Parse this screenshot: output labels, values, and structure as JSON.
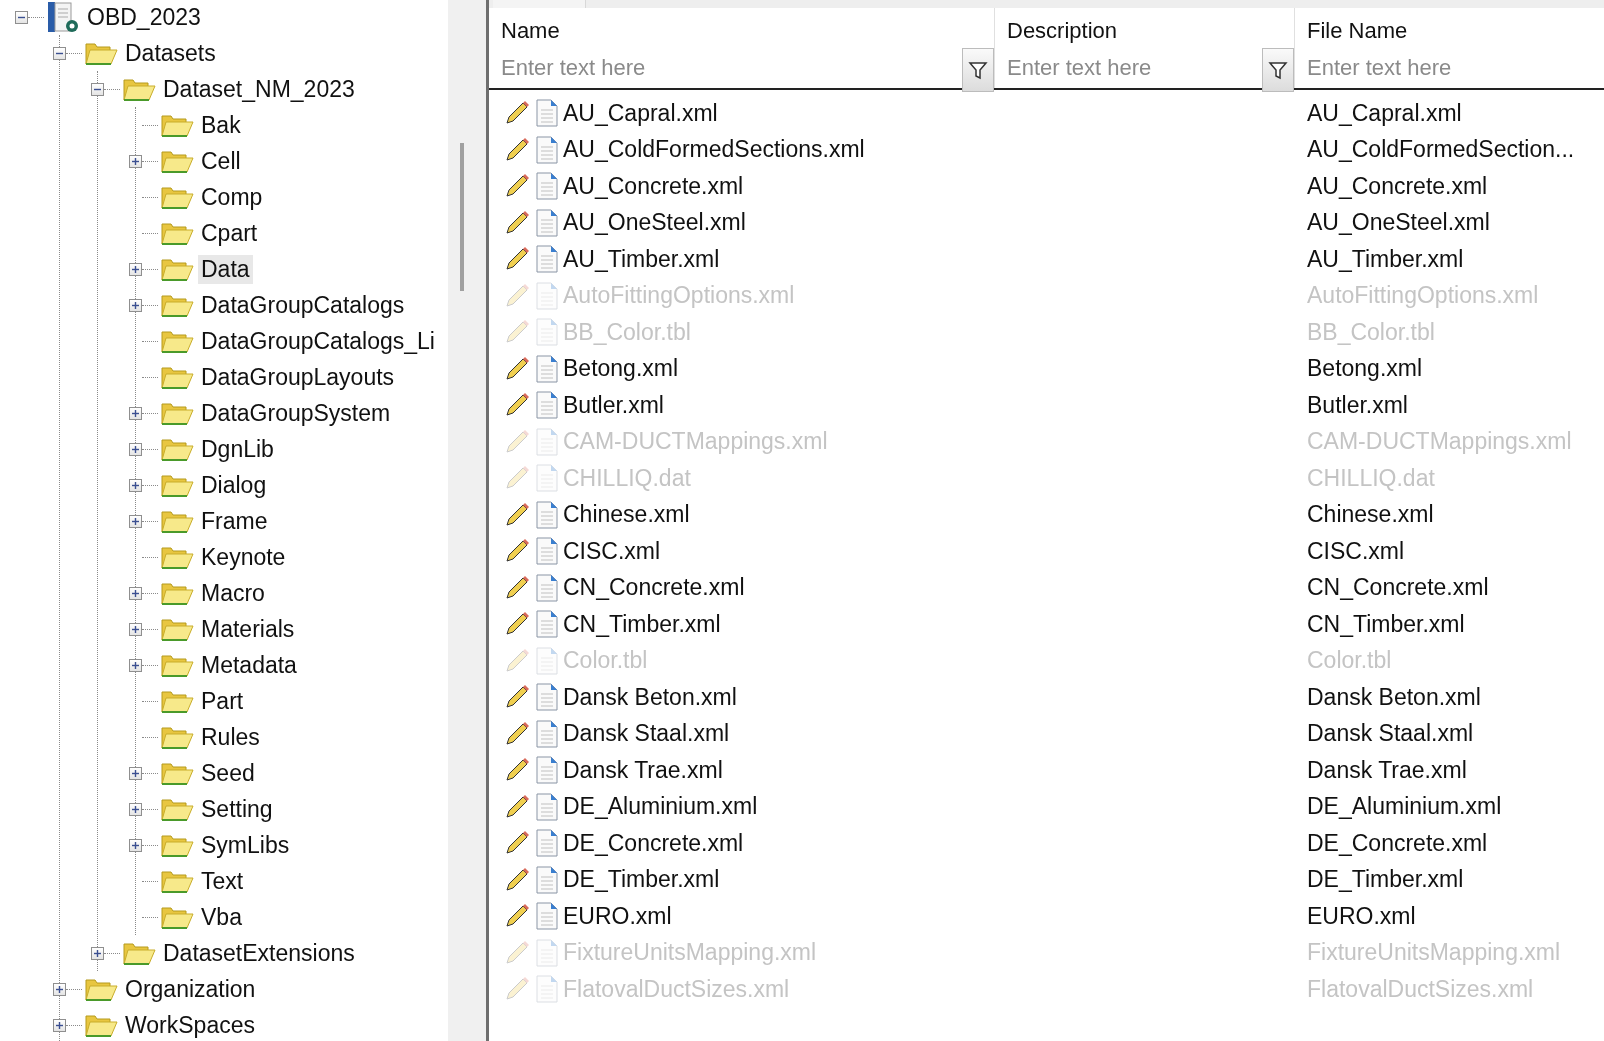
{
  "tree": [
    {
      "label": "OBD_2023",
      "kind": "root",
      "expandable": true,
      "expanded": true,
      "selected": false,
      "children": [
        {
          "label": "Datasets",
          "kind": "folder",
          "expandable": true,
          "expanded": true,
          "selected": false,
          "children": [
            {
              "label": "Dataset_NM_2023",
              "kind": "folder",
              "expandable": true,
              "expanded": true,
              "selected": false,
              "children": [
                {
                  "label": "Bak",
                  "kind": "folder",
                  "expandable": false,
                  "expanded": false,
                  "selected": false
                },
                {
                  "label": "Cell",
                  "kind": "folder",
                  "expandable": true,
                  "expanded": false,
                  "selected": false
                },
                {
                  "label": "Comp",
                  "kind": "folder",
                  "expandable": false,
                  "expanded": false,
                  "selected": false
                },
                {
                  "label": "Cpart",
                  "kind": "folder",
                  "expandable": false,
                  "expanded": false,
                  "selected": false
                },
                {
                  "label": "Data",
                  "kind": "folder",
                  "expandable": true,
                  "expanded": false,
                  "selected": true
                },
                {
                  "label": "DataGroupCatalogs",
                  "kind": "folder",
                  "expandable": true,
                  "expanded": false,
                  "selected": false
                },
                {
                  "label": "DataGroupCatalogs_Li",
                  "kind": "folder",
                  "expandable": false,
                  "expanded": false,
                  "selected": false
                },
                {
                  "label": "DataGroupLayouts",
                  "kind": "folder",
                  "expandable": false,
                  "expanded": false,
                  "selected": false
                },
                {
                  "label": "DataGroupSystem",
                  "kind": "folder",
                  "expandable": true,
                  "expanded": false,
                  "selected": false
                },
                {
                  "label": "DgnLib",
                  "kind": "folder",
                  "expandable": true,
                  "expanded": false,
                  "selected": false
                },
                {
                  "label": "Dialog",
                  "kind": "folder",
                  "expandable": true,
                  "expanded": false,
                  "selected": false
                },
                {
                  "label": "Frame",
                  "kind": "folder",
                  "expandable": true,
                  "expanded": false,
                  "selected": false
                },
                {
                  "label": "Keynote",
                  "kind": "folder",
                  "expandable": false,
                  "expanded": false,
                  "selected": false
                },
                {
                  "label": "Macro",
                  "kind": "folder",
                  "expandable": true,
                  "expanded": false,
                  "selected": false
                },
                {
                  "label": "Materials",
                  "kind": "folder",
                  "expandable": true,
                  "expanded": false,
                  "selected": false
                },
                {
                  "label": "Metadata",
                  "kind": "folder",
                  "expandable": true,
                  "expanded": false,
                  "selected": false
                },
                {
                  "label": "Part",
                  "kind": "folder",
                  "expandable": false,
                  "expanded": false,
                  "selected": false
                },
                {
                  "label": "Rules",
                  "kind": "folder",
                  "expandable": false,
                  "expanded": false,
                  "selected": false
                },
                {
                  "label": "Seed",
                  "kind": "folder",
                  "expandable": true,
                  "expanded": false,
                  "selected": false
                },
                {
                  "label": "Setting",
                  "kind": "folder",
                  "expandable": true,
                  "expanded": false,
                  "selected": false
                },
                {
                  "label": "SymLibs",
                  "kind": "folder",
                  "expandable": true,
                  "expanded": false,
                  "selected": false
                },
                {
                  "label": "Text",
                  "kind": "folder",
                  "expandable": false,
                  "expanded": false,
                  "selected": false
                },
                {
                  "label": "Vba",
                  "kind": "folder",
                  "expandable": false,
                  "expanded": false,
                  "selected": false
                }
              ]
            },
            {
              "label": "DatasetExtensions",
              "kind": "folder",
              "expandable": true,
              "expanded": false,
              "selected": false
            }
          ]
        },
        {
          "label": "Organization",
          "kind": "folder",
          "expandable": true,
          "expanded": false,
          "selected": false
        },
        {
          "label": "WorkSpaces",
          "kind": "folder",
          "expandable": true,
          "expanded": false,
          "selected": false
        }
      ]
    }
  ],
  "table": {
    "columns": [
      {
        "title": "Name",
        "placeholder": "Enter text here"
      },
      {
        "title": "Description",
        "placeholder": "Enter text here"
      },
      {
        "title": "File Name",
        "placeholder": "Enter text here"
      }
    ],
    "rows": [
      {
        "name": "AU_Capral.xml",
        "file_name": "AU_Capral.xml",
        "disabled": false
      },
      {
        "name": "AU_ColdFormedSections.xml",
        "file_name": "AU_ColdFormedSection...",
        "disabled": false
      },
      {
        "name": "AU_Concrete.xml",
        "file_name": "AU_Concrete.xml",
        "disabled": false
      },
      {
        "name": "AU_OneSteel.xml",
        "file_name": "AU_OneSteel.xml",
        "disabled": false
      },
      {
        "name": "AU_Timber.xml",
        "file_name": "AU_Timber.xml",
        "disabled": false
      },
      {
        "name": "AutoFittingOptions.xml",
        "file_name": "AutoFittingOptions.xml",
        "disabled": true
      },
      {
        "name": "BB_Color.tbl",
        "file_name": "BB_Color.tbl",
        "disabled": true
      },
      {
        "name": "Betong.xml",
        "file_name": "Betong.xml",
        "disabled": false
      },
      {
        "name": "Butler.xml",
        "file_name": "Butler.xml",
        "disabled": false
      },
      {
        "name": "CAM-DUCTMappings.xml",
        "file_name": "CAM-DUCTMappings.xml",
        "disabled": true
      },
      {
        "name": "CHILLIQ.dat",
        "file_name": "CHILLIQ.dat",
        "disabled": true
      },
      {
        "name": "Chinese.xml",
        "file_name": "Chinese.xml",
        "disabled": false
      },
      {
        "name": "CISC.xml",
        "file_name": "CISC.xml",
        "disabled": false
      },
      {
        "name": "CN_Concrete.xml",
        "file_name": "CN_Concrete.xml",
        "disabled": false
      },
      {
        "name": "CN_Timber.xml",
        "file_name": "CN_Timber.xml",
        "disabled": false
      },
      {
        "name": "Color.tbl",
        "file_name": "Color.tbl",
        "disabled": true
      },
      {
        "name": "Dansk Beton.xml",
        "file_name": "Dansk Beton.xml",
        "disabled": false
      },
      {
        "name": "Dansk Staal.xml",
        "file_name": "Dansk Staal.xml",
        "disabled": false
      },
      {
        "name": "Dansk Trae.xml",
        "file_name": "Dansk Trae.xml",
        "disabled": false
      },
      {
        "name": "DE_Aluminium.xml",
        "file_name": "DE_Aluminium.xml",
        "disabled": false
      },
      {
        "name": "DE_Concrete.xml",
        "file_name": "DE_Concrete.xml",
        "disabled": false
      },
      {
        "name": "DE_Timber.xml",
        "file_name": "DE_Timber.xml",
        "disabled": false
      },
      {
        "name": "EURO.xml",
        "file_name": "EURO.xml",
        "disabled": false
      },
      {
        "name": "FixtureUnitsMapping.xml",
        "file_name": "FixtureUnitsMapping.xml",
        "disabled": true
      },
      {
        "name": "FlatovalDuctSizes.xml",
        "file_name": "FlatovalDuctSizes.xml",
        "disabled": true
      }
    ]
  }
}
